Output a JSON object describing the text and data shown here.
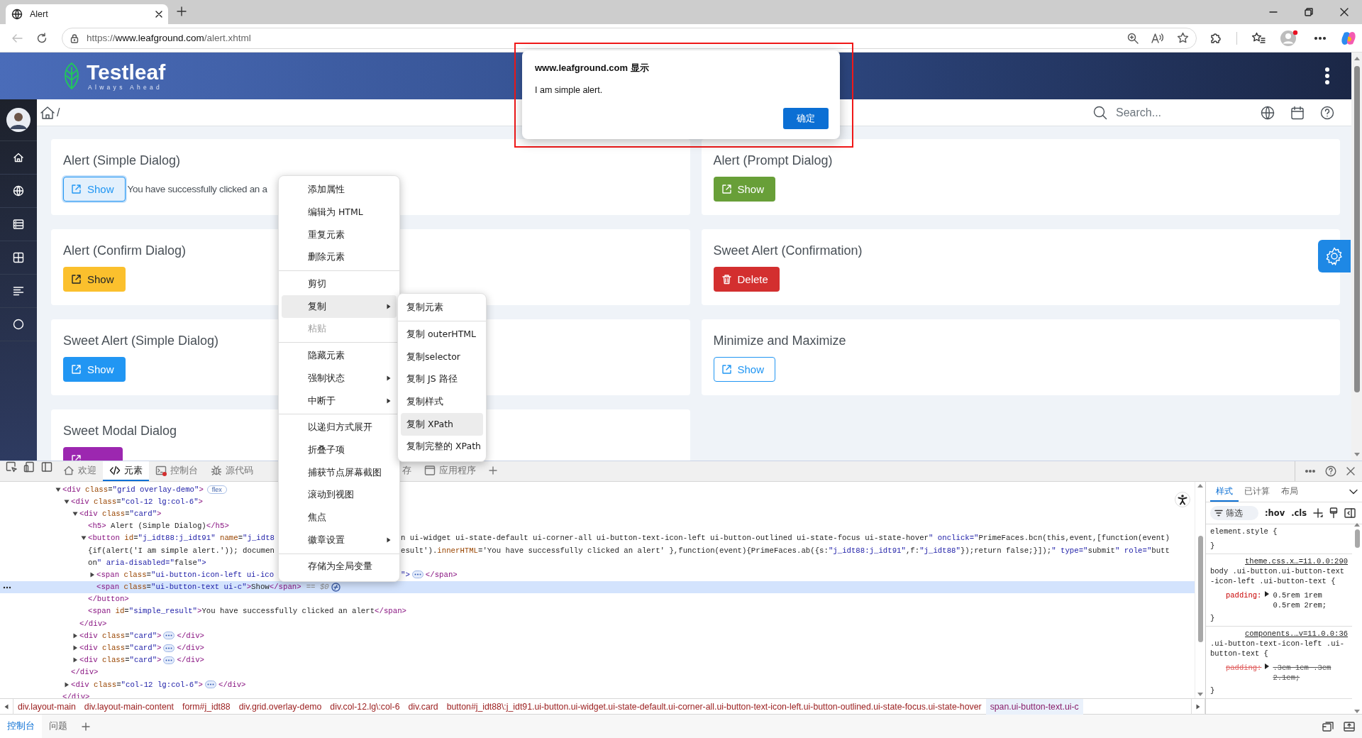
{
  "browser": {
    "tab": {
      "title": "Alert"
    },
    "url": "https://www.leafground.com/alert.xhtml"
  },
  "site": {
    "brand": "Testleaf",
    "tagline": "Always Ahead",
    "breadcrumb_separator": "/",
    "search": {
      "placeholder": "Search..."
    },
    "cards_left": [
      {
        "title": "Alert (Simple Dialog)",
        "button": {
          "label": "Show"
        },
        "result": "You have successfully clicked an a"
      },
      {
        "title": "Alert (Confirm Dialog)",
        "button": {
          "label": "Show"
        }
      },
      {
        "title": "Sweet Alert (Simple Dialog)",
        "button": {
          "label": "Show"
        }
      },
      {
        "title": "Sweet Modal Dialog"
      }
    ],
    "cards_right": [
      {
        "title": "Alert (Prompt Dialog)",
        "button": {
          "label": "Show"
        }
      },
      {
        "title": "Sweet Alert (Confirmation)",
        "button": {
          "label": "Delete"
        }
      },
      {
        "title": "Minimize and Maximize",
        "button": {
          "label": "Show"
        }
      }
    ]
  },
  "alert_dialog": {
    "title": "www.leafground.com 显示",
    "message": "I am simple alert.",
    "button": "确定"
  },
  "context_menu": {
    "items": [
      {
        "kind": "item",
        "label": "添加属性",
        "disabled": false,
        "has_submenu": false,
        "selected": false
      },
      {
        "kind": "item",
        "label": "编辑为 HTML",
        "disabled": false,
        "has_submenu": false,
        "selected": false
      },
      {
        "kind": "item",
        "label": "重复元素",
        "disabled": false,
        "has_submenu": false,
        "selected": false
      },
      {
        "kind": "item",
        "label": "删除元素",
        "disabled": false,
        "has_submenu": false,
        "selected": false
      },
      {
        "kind": "separator"
      },
      {
        "kind": "item",
        "label": "剪切",
        "disabled": false,
        "has_submenu": false,
        "selected": false
      },
      {
        "kind": "item",
        "label": "复制",
        "disabled": false,
        "has_submenu": true,
        "selected": true
      },
      {
        "kind": "item",
        "label": "粘贴",
        "disabled": true,
        "has_submenu": false,
        "selected": false
      },
      {
        "kind": "separator"
      },
      {
        "kind": "item",
        "label": "隐藏元素",
        "disabled": false,
        "has_submenu": false,
        "selected": false
      },
      {
        "kind": "item",
        "label": "强制状态",
        "disabled": false,
        "has_submenu": true,
        "selected": false
      },
      {
        "kind": "item",
        "label": "中断于",
        "disabled": false,
        "has_submenu": true,
        "selected": false
      },
      {
        "kind": "separator"
      },
      {
        "kind": "item",
        "label": "以递归方式展开",
        "disabled": false,
        "has_submenu": false,
        "selected": false
      },
      {
        "kind": "item",
        "label": "折叠子项",
        "disabled": false,
        "has_submenu": false,
        "selected": false
      },
      {
        "kind": "item",
        "label": "捕获节点屏幕截图",
        "disabled": false,
        "has_submenu": false,
        "selected": false
      },
      {
        "kind": "item",
        "label": "滚动到视图",
        "disabled": false,
        "has_submenu": false,
        "selected": false
      },
      {
        "kind": "item",
        "label": "焦点",
        "disabled": false,
        "has_submenu": false,
        "selected": false
      },
      {
        "kind": "item",
        "label": "徽章设置",
        "disabled": false,
        "has_submenu": true,
        "selected": false
      },
      {
        "kind": "separator"
      },
      {
        "kind": "item",
        "label": "存储为全局变量",
        "disabled": false,
        "has_submenu": false,
        "selected": false
      }
    ]
  },
  "submenu": {
    "items": [
      {
        "kind": "item",
        "label": "复制元素",
        "selected": false
      },
      {
        "kind": "separator"
      },
      {
        "kind": "item",
        "label": "复制 outerHTML",
        "selected": false
      },
      {
        "kind": "item",
        "label": "复制selector",
        "selected": false
      },
      {
        "kind": "item",
        "label": "复制 JS 路径",
        "selected": false
      },
      {
        "kind": "item",
        "label": "复制样式",
        "selected": false
      },
      {
        "kind": "item",
        "label": "复制 XPath",
        "selected": true
      },
      {
        "kind": "item",
        "label": "复制完整的 XPath",
        "selected": false
      }
    ]
  },
  "devtools": {
    "tabs": [
      {
        "label": "欢迎",
        "selected": false
      },
      {
        "label": "元素",
        "selected": true
      },
      {
        "label": "控制台",
        "selected": false
      },
      {
        "label": "源代码",
        "selected": false
      },
      {
        "label": "存",
        "selected": false
      },
      {
        "label": "应用程序",
        "selected": false
      }
    ],
    "dom_tree": [
      {
        "lines": [
          {
            "parts": [
              {
                "kind": "code",
                "text": "<div class=\"grid overlay-demo\">"
              },
              {
                "kind": "badge",
                "text": "flex"
              }
            ]
          }
        ],
        "expanded": true,
        "selected": false,
        "close": "</div>",
        "children": [
          {
            "lines": [
              {
                "parts": [
                  {
                    "kind": "code",
                    "text": "<div class=\"col-12 lg:col-6\">"
                  }
                ]
              }
            ],
            "expanded": true,
            "selected": false,
            "close": "</div>",
            "children": [
              {
                "lines": [
                  {
                    "parts": [
                      {
                        "kind": "code",
                        "text": "<div class=\"card\">"
                      }
                    ]
                  }
                ],
                "expanded": true,
                "selected": false,
                "close": "</div>",
                "children": [
                  {
                    "lines": [
                      {
                        "parts": [
                          {
                            "kind": "code",
                            "text": "<h5> Alert (Simple Dialog)</h5>"
                          }
                        ]
                      }
                    ],
                    "selected": false
                  },
                  {
                    "lines": [
                      {
                        "parts": [
                          {
                            "kind": "code",
                            "text": "<button id=\"j_idt88:j_idt91\" name=\"j_idt8"
                          }
                        ],
                        "parts_after_menu": [
                          {
                            "kind": "code",
                            "text": "n ui-widget ui-state-default ui-corner-all ui-button-text-icon-left ui-button-outlined ui-state-focus ui-state-hover\" onclick=\"PrimeFaces.bcn(this,event,[function(event)"
                          }
                        ]
                      },
                      {
                        "parts": [
                          {
                            "kind": "code",
                            "text": "{if(alert('I am simple alert.')); documen"
                          }
                        ],
                        "parts_after_menu": [
                          {
                            "kind": "code",
                            "text": "esult').innerHTML='You have successfully clicked an alert' },function(event){PrimeFaces.ab({s:\"j_idt88:j_idt91\",f:\"j_idt88\"});return false;}]);\" type=\"submit\" role=\"butt"
                          }
                        ]
                      },
                      {
                        "parts": [
                          {
                            "kind": "code",
                            "text": "on\" aria-disabled=\"false\">"
                          }
                        ]
                      }
                    ],
                    "expanded": true,
                    "selected": false,
                    "close": "</button>",
                    "children": [
                      {
                        "lines": [
                          {
                            "parts": [
                              {
                                "kind": "code",
                                "text": "<span class=\"ui-button-icon-left ui-ico"
                              }
                            ],
                            "parts_after_menu": [
                              {
                                "kind": "code",
                                "text": "\">"
                              },
                              {
                                "kind": "ellipsis"
                              },
                              {
                                "kind": "code",
                                "text": "</span>"
                              }
                            ]
                          }
                        ],
                        "expanded": false,
                        "selected": false
                      },
                      {
                        "lines": [
                          {
                            "parts": [
                              {
                                "kind": "code",
                                "text": "<span class=\"ui-button-text ui-c\">Show</span>"
                              },
                              {
                                "kind": "marker",
                                "text": "== $0"
                              }
                            ]
                          }
                        ],
                        "selected": true
                      }
                    ]
                  },
                  {
                    "lines": [
                      {
                        "parts": [
                          {
                            "kind": "code",
                            "text": "<span id=\"simple_result\">You have successfully clicked an alert</span>"
                          }
                        ]
                      }
                    ],
                    "selected": false
                  }
                ]
              },
              {
                "lines": [
                  {
                    "parts": [
                      {
                        "kind": "code",
                        "text": "<div class=\"card\">"
                      },
                      {
                        "kind": "ellipsis"
                      },
                      {
                        "kind": "code",
                        "text": "</div>"
                      }
                    ]
                  }
                ],
                "expanded": false,
                "selected": false
              },
              {
                "lines": [
                  {
                    "parts": [
                      {
                        "kind": "code",
                        "text": "<div class=\"card\">"
                      },
                      {
                        "kind": "ellipsis"
                      },
                      {
                        "kind": "code",
                        "text": "</div>"
                      }
                    ]
                  }
                ],
                "expanded": false,
                "selected": false
              },
              {
                "lines": [
                  {
                    "parts": [
                      {
                        "kind": "code",
                        "text": "<div class=\"card\">"
                      },
                      {
                        "kind": "ellipsis"
                      },
                      {
                        "kind": "code",
                        "text": "</div>"
                      }
                    ]
                  }
                ],
                "expanded": false,
                "selected": false
              }
            ]
          },
          {
            "lines": [
              {
                "parts": [
                  {
                    "kind": "code",
                    "text": "<div class=\"col-12 lg:col-6\">"
                  },
                  {
                    "kind": "ellipsis"
                  },
                  {
                    "kind": "code",
                    "text": "</div>"
                  }
                ]
              }
            ],
            "expanded": false,
            "selected": false
          }
        ]
      }
    ],
    "breadcrumbs": [
      {
        "label": "div.layout-main",
        "selected": false
      },
      {
        "label": "div.layout-main-content",
        "selected": false
      },
      {
        "label": "form#j_idt88",
        "selected": false
      },
      {
        "label": "div.grid.overlay-demo",
        "selected": false
      },
      {
        "label": "div.col-12.lg\\:col-6",
        "selected": false
      },
      {
        "label": "div.card",
        "selected": false
      },
      {
        "label": "button#j_idt88\\:j_idt91.ui-button.ui-widget.ui-state-default.ui-corner-all.ui-button-text-icon-left.ui-button-outlined.ui-state-focus.ui-state-hover",
        "selected": false
      },
      {
        "label": "span.ui-button-text.ui-c",
        "selected": true
      }
    ],
    "styles": {
      "tabs": [
        {
          "label": "样式",
          "selected": true
        },
        {
          "label": "已计算",
          "selected": false
        },
        {
          "label": "布局",
          "selected": false
        }
      ],
      "filter_placeholder": "筛选",
      "toggles": [
        ":hov",
        ".cls"
      ],
      "rules": [
        {
          "selector": "element.style {",
          "close": "}"
        },
        {
          "selector": "body .ui-button.ui-button-text-icon-left .ui-button-text {",
          "source": "theme.css.x…=11.0.0:290",
          "declarations": [
            {
              "property": "padding:",
              "value": "0.5rem 1rem 0.5rem 2rem;",
              "overridden": false
            }
          ],
          "close": "}"
        },
        {
          "selector": ".ui-button-text-icon-left .ui-button-text {",
          "source": "components.…v=11.0.0:36",
          "declarations": [
            {
              "property": "padding:",
              "value": ".3em 1em .3em 2.1em;",
              "overridden": true
            }
          ],
          "close": "}"
        }
      ]
    },
    "drawer_tabs": [
      {
        "label": "控制台",
        "selected": true
      },
      {
        "label": "问题",
        "selected": false
      }
    ]
  }
}
